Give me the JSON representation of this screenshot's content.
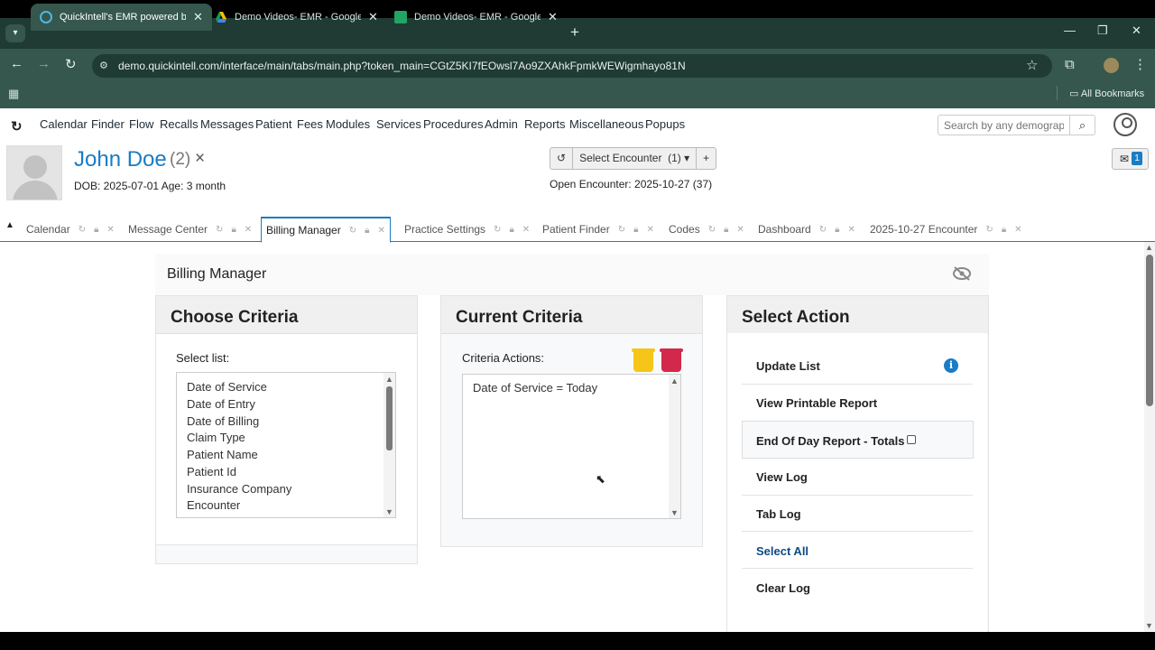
{
  "browser": {
    "tabs": [
      {
        "title": "QuickIntell's EMR powered by O",
        "active": true
      },
      {
        "title": "Demo Videos- EMR - Google Dri",
        "active": false
      },
      {
        "title": "Demo Videos- EMR - Google She",
        "active": false
      }
    ],
    "url": "demo.quickintell.com/interface/main/tabs/main.php?token_main=CGtZ5KI7fEOwsl7Ao9ZXAhkFpmkWEWigmhayo81N",
    "all_bookmarks": "All Bookmarks"
  },
  "menu": [
    "Calendar",
    "Finder",
    "Flow",
    "Recalls",
    "Messages",
    "Patient",
    "Fees",
    "Modules",
    "Services",
    "Procedures",
    "Admin",
    "Reports",
    "Miscellaneous",
    "Popups"
  ],
  "search": {
    "placeholder": "Search by any demographics"
  },
  "patient": {
    "name": "John Doe",
    "count": "(2)",
    "close": "×",
    "dob_line": "DOB: 2025-07-01 Age: 3 month"
  },
  "encounter": {
    "select_label": "Select Encounter",
    "count": "(1)",
    "open_line": "Open Encounter: 2025-10-27 (37)"
  },
  "mail": {
    "badge": "1"
  },
  "app_tabs": [
    "Calendar",
    "Message Center",
    "Billing Manager",
    "Practice Settings",
    "Patient Finder",
    "Codes",
    "Dashboard",
    "2025-10-27 Encounter"
  ],
  "active_tab": "Billing Manager",
  "billing": {
    "title": "Billing Manager",
    "choose": {
      "heading": "Choose Criteria",
      "select_label": "Select list:",
      "items": [
        "Date of Service",
        "Date of Entry",
        "Date of Billing",
        "Claim Type",
        "Patient Name",
        "Patient Id",
        "Insurance Company",
        "Encounter"
      ]
    },
    "current": {
      "heading": "Current Criteria",
      "actions_label": "Criteria Actions:",
      "criteria": [
        "Date of Service = Today"
      ]
    },
    "actions": {
      "heading": "Select Action",
      "items": [
        "Update List",
        "View Printable Report",
        "End Of Day Report - Totals",
        "View Log",
        "Tab Log",
        "Select All",
        "Clear Log"
      ]
    }
  },
  "colors": {
    "accent": "#1a7cc4",
    "yellow_trash": "#f5c518",
    "red_trash": "#d4284a",
    "chrome_dark": "#1f3b33",
    "chrome": "#35574d"
  }
}
